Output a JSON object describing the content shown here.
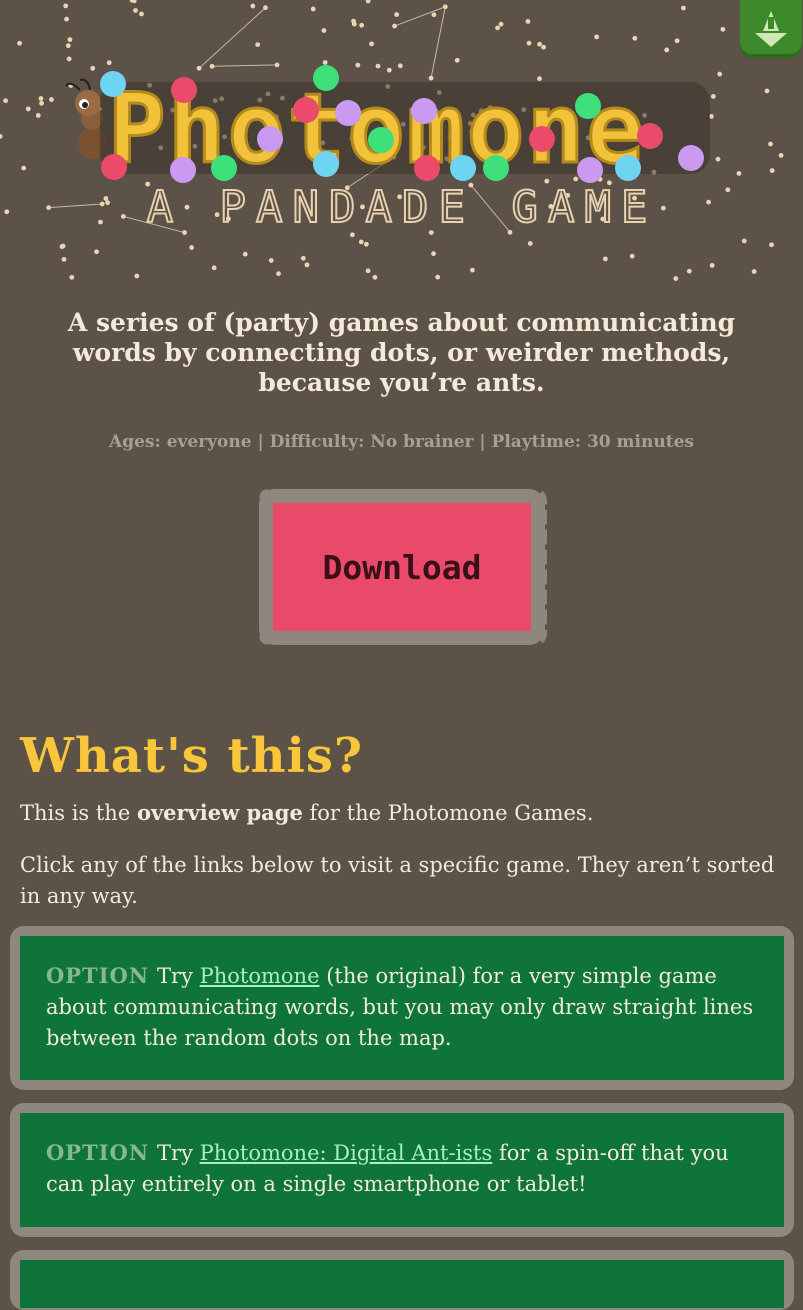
{
  "header": {
    "logo_text": "Photomone",
    "logo_subtitle": "A PANDADE GAME",
    "home_icon": "home-arrow-icon"
  },
  "tagline": "A series of (party) games about communicating words by connecting dots, or weirder methods, because you’re ants.",
  "meta": "Ages: everyone | Difficulty: No brainer | Playtime: 30 minutes",
  "download_label": "Download",
  "whats_this": {
    "title": "What's this?",
    "p1_before": "This is the ",
    "p1_bold": "overview page",
    "p1_after": " for the Photomone Games.",
    "p2": "Click any of the links below to visit a specific game. They aren’t sorted in any way."
  },
  "options": [
    {
      "tag": "OPTION",
      "before": "Try ",
      "link": "Photomone",
      "after": " (the original) for a very simple game about communicating words, but you may only draw straight lines between the random dots on the map."
    },
    {
      "tag": "OPTION",
      "before": "Try ",
      "link": "Photomone: Digital Ant-ists",
      "after": " for a spin-off that you can play entirely on a single smartphone or tablet!"
    }
  ],
  "colors": {
    "background": "#5c5248",
    "title_yellow": "#f7c63a",
    "download_pink": "#ea4a6a",
    "card_green": "#0f743a",
    "frame_gray": "#8f877d"
  }
}
